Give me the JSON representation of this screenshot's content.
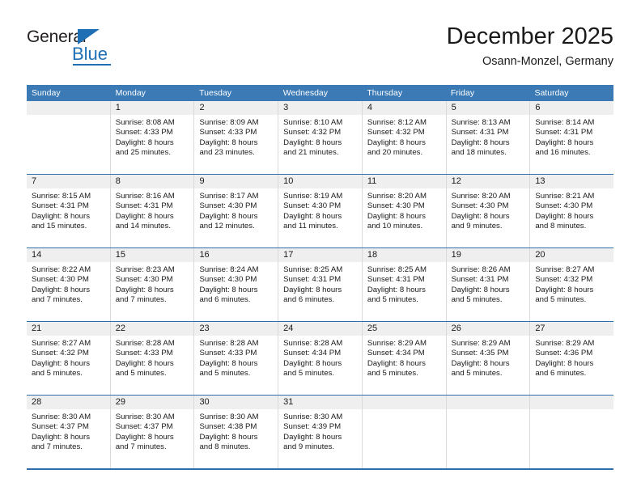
{
  "logo": {
    "text_primary": "General",
    "text_secondary": "Blue",
    "triangle_icon": "triangle-icon",
    "brand_color": "#1f6fb5"
  },
  "header": {
    "month_title": "December 2025",
    "location": "Osann-Monzel, Germany"
  },
  "calendar": {
    "header_color": "#3b7ab5",
    "daynum_bg": "#efefef",
    "day_headers": [
      "Sunday",
      "Monday",
      "Tuesday",
      "Wednesday",
      "Thursday",
      "Friday",
      "Saturday"
    ],
    "weeks": [
      [
        {
          "day": "",
          "sunrise": "",
          "sunset": "",
          "daylight1": "",
          "daylight2": ""
        },
        {
          "day": "1",
          "sunrise": "Sunrise: 8:08 AM",
          "sunset": "Sunset: 4:33 PM",
          "daylight1": "Daylight: 8 hours",
          "daylight2": "and 25 minutes."
        },
        {
          "day": "2",
          "sunrise": "Sunrise: 8:09 AM",
          "sunset": "Sunset: 4:33 PM",
          "daylight1": "Daylight: 8 hours",
          "daylight2": "and 23 minutes."
        },
        {
          "day": "3",
          "sunrise": "Sunrise: 8:10 AM",
          "sunset": "Sunset: 4:32 PM",
          "daylight1": "Daylight: 8 hours",
          "daylight2": "and 21 minutes."
        },
        {
          "day": "4",
          "sunrise": "Sunrise: 8:12 AM",
          "sunset": "Sunset: 4:32 PM",
          "daylight1": "Daylight: 8 hours",
          "daylight2": "and 20 minutes."
        },
        {
          "day": "5",
          "sunrise": "Sunrise: 8:13 AM",
          "sunset": "Sunset: 4:31 PM",
          "daylight1": "Daylight: 8 hours",
          "daylight2": "and 18 minutes."
        },
        {
          "day": "6",
          "sunrise": "Sunrise: 8:14 AM",
          "sunset": "Sunset: 4:31 PM",
          "daylight1": "Daylight: 8 hours",
          "daylight2": "and 16 minutes."
        }
      ],
      [
        {
          "day": "7",
          "sunrise": "Sunrise: 8:15 AM",
          "sunset": "Sunset: 4:31 PM",
          "daylight1": "Daylight: 8 hours",
          "daylight2": "and 15 minutes."
        },
        {
          "day": "8",
          "sunrise": "Sunrise: 8:16 AM",
          "sunset": "Sunset: 4:31 PM",
          "daylight1": "Daylight: 8 hours",
          "daylight2": "and 14 minutes."
        },
        {
          "day": "9",
          "sunrise": "Sunrise: 8:17 AM",
          "sunset": "Sunset: 4:30 PM",
          "daylight1": "Daylight: 8 hours",
          "daylight2": "and 12 minutes."
        },
        {
          "day": "10",
          "sunrise": "Sunrise: 8:19 AM",
          "sunset": "Sunset: 4:30 PM",
          "daylight1": "Daylight: 8 hours",
          "daylight2": "and 11 minutes."
        },
        {
          "day": "11",
          "sunrise": "Sunrise: 8:20 AM",
          "sunset": "Sunset: 4:30 PM",
          "daylight1": "Daylight: 8 hours",
          "daylight2": "and 10 minutes."
        },
        {
          "day": "12",
          "sunrise": "Sunrise: 8:20 AM",
          "sunset": "Sunset: 4:30 PM",
          "daylight1": "Daylight: 8 hours",
          "daylight2": "and 9 minutes."
        },
        {
          "day": "13",
          "sunrise": "Sunrise: 8:21 AM",
          "sunset": "Sunset: 4:30 PM",
          "daylight1": "Daylight: 8 hours",
          "daylight2": "and 8 minutes."
        }
      ],
      [
        {
          "day": "14",
          "sunrise": "Sunrise: 8:22 AM",
          "sunset": "Sunset: 4:30 PM",
          "daylight1": "Daylight: 8 hours",
          "daylight2": "and 7 minutes."
        },
        {
          "day": "15",
          "sunrise": "Sunrise: 8:23 AM",
          "sunset": "Sunset: 4:30 PM",
          "daylight1": "Daylight: 8 hours",
          "daylight2": "and 7 minutes."
        },
        {
          "day": "16",
          "sunrise": "Sunrise: 8:24 AM",
          "sunset": "Sunset: 4:30 PM",
          "daylight1": "Daylight: 8 hours",
          "daylight2": "and 6 minutes."
        },
        {
          "day": "17",
          "sunrise": "Sunrise: 8:25 AM",
          "sunset": "Sunset: 4:31 PM",
          "daylight1": "Daylight: 8 hours",
          "daylight2": "and 6 minutes."
        },
        {
          "day": "18",
          "sunrise": "Sunrise: 8:25 AM",
          "sunset": "Sunset: 4:31 PM",
          "daylight1": "Daylight: 8 hours",
          "daylight2": "and 5 minutes."
        },
        {
          "day": "19",
          "sunrise": "Sunrise: 8:26 AM",
          "sunset": "Sunset: 4:31 PM",
          "daylight1": "Daylight: 8 hours",
          "daylight2": "and 5 minutes."
        },
        {
          "day": "20",
          "sunrise": "Sunrise: 8:27 AM",
          "sunset": "Sunset: 4:32 PM",
          "daylight1": "Daylight: 8 hours",
          "daylight2": "and 5 minutes."
        }
      ],
      [
        {
          "day": "21",
          "sunrise": "Sunrise: 8:27 AM",
          "sunset": "Sunset: 4:32 PM",
          "daylight1": "Daylight: 8 hours",
          "daylight2": "and 5 minutes."
        },
        {
          "day": "22",
          "sunrise": "Sunrise: 8:28 AM",
          "sunset": "Sunset: 4:33 PM",
          "daylight1": "Daylight: 8 hours",
          "daylight2": "and 5 minutes."
        },
        {
          "day": "23",
          "sunrise": "Sunrise: 8:28 AM",
          "sunset": "Sunset: 4:33 PM",
          "daylight1": "Daylight: 8 hours",
          "daylight2": "and 5 minutes."
        },
        {
          "day": "24",
          "sunrise": "Sunrise: 8:28 AM",
          "sunset": "Sunset: 4:34 PM",
          "daylight1": "Daylight: 8 hours",
          "daylight2": "and 5 minutes."
        },
        {
          "day": "25",
          "sunrise": "Sunrise: 8:29 AM",
          "sunset": "Sunset: 4:34 PM",
          "daylight1": "Daylight: 8 hours",
          "daylight2": "and 5 minutes."
        },
        {
          "day": "26",
          "sunrise": "Sunrise: 8:29 AM",
          "sunset": "Sunset: 4:35 PM",
          "daylight1": "Daylight: 8 hours",
          "daylight2": "and 5 minutes."
        },
        {
          "day": "27",
          "sunrise": "Sunrise: 8:29 AM",
          "sunset": "Sunset: 4:36 PM",
          "daylight1": "Daylight: 8 hours",
          "daylight2": "and 6 minutes."
        }
      ],
      [
        {
          "day": "28",
          "sunrise": "Sunrise: 8:30 AM",
          "sunset": "Sunset: 4:37 PM",
          "daylight1": "Daylight: 8 hours",
          "daylight2": "and 7 minutes."
        },
        {
          "day": "29",
          "sunrise": "Sunrise: 8:30 AM",
          "sunset": "Sunset: 4:37 PM",
          "daylight1": "Daylight: 8 hours",
          "daylight2": "and 7 minutes."
        },
        {
          "day": "30",
          "sunrise": "Sunrise: 8:30 AM",
          "sunset": "Sunset: 4:38 PM",
          "daylight1": "Daylight: 8 hours",
          "daylight2": "and 8 minutes."
        },
        {
          "day": "31",
          "sunrise": "Sunrise: 8:30 AM",
          "sunset": "Sunset: 4:39 PM",
          "daylight1": "Daylight: 8 hours",
          "daylight2": "and 9 minutes."
        },
        {
          "day": "",
          "sunrise": "",
          "sunset": "",
          "daylight1": "",
          "daylight2": ""
        },
        {
          "day": "",
          "sunrise": "",
          "sunset": "",
          "daylight1": "",
          "daylight2": ""
        },
        {
          "day": "",
          "sunrise": "",
          "sunset": "",
          "daylight1": "",
          "daylight2": ""
        }
      ]
    ]
  }
}
